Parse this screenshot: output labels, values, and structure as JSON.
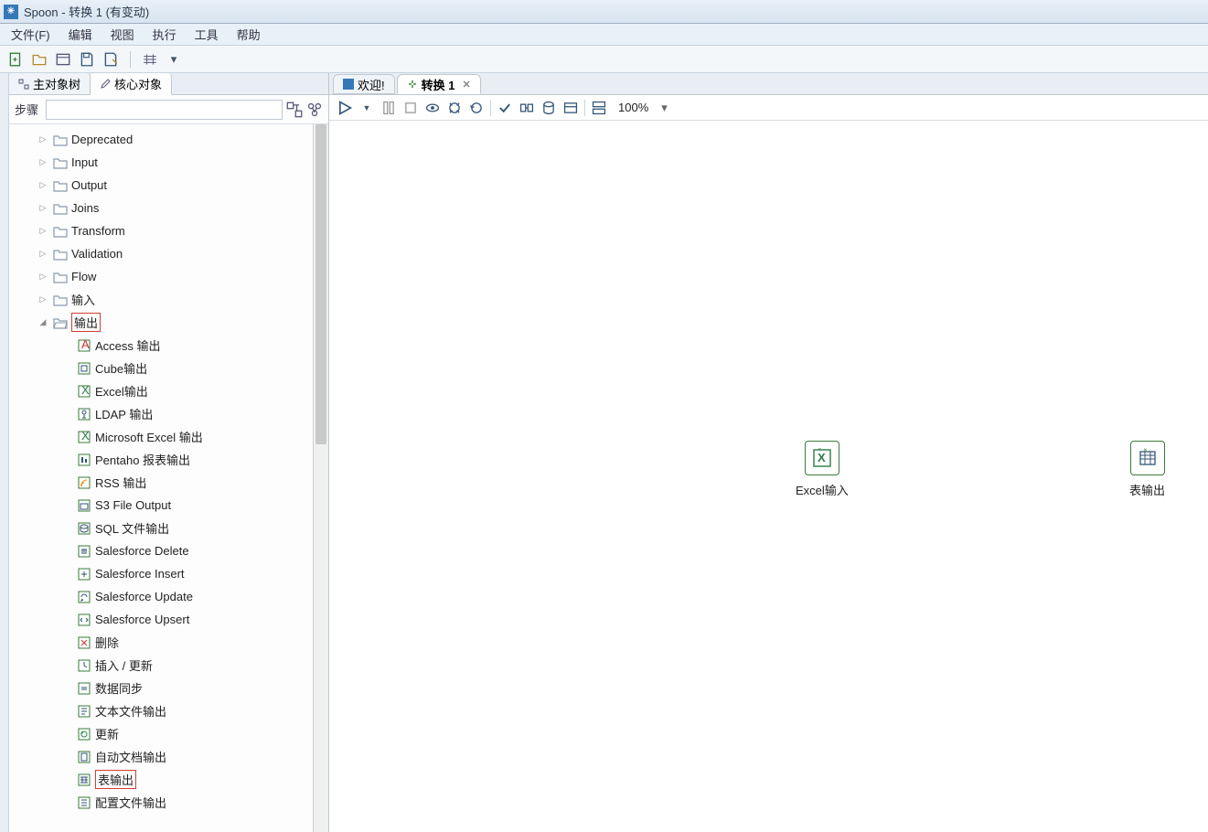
{
  "window": {
    "title": "Spoon - 转换 1 (有变动)"
  },
  "menu": {
    "file": "文件(F)",
    "edit": "编辑",
    "view": "视图",
    "run": "执行",
    "tools": "工具",
    "help": "帮助"
  },
  "sideTabs": {
    "objectTree": "主对象树",
    "coreObjects": "核心对象"
  },
  "search": {
    "label": "步骤"
  },
  "tree": {
    "folders": {
      "deprecated": "Deprecated",
      "input": "Input",
      "output": "Output",
      "joins": "Joins",
      "transform": "Transform",
      "validation": "Validation",
      "flow": "Flow",
      "inputCn": "输入",
      "outputCn": "输出"
    },
    "outputSteps": {
      "access": "Access 输出",
      "cube": "Cube输出",
      "excel": "Excel输出",
      "ldap": "LDAP 输出",
      "msexcel": "Microsoft Excel 输出",
      "pentaho": "Pentaho 报表输出",
      "rss": "RSS 输出",
      "s3": "S3 File Output",
      "sql": "SQL 文件输出",
      "sfdelete": "Salesforce Delete",
      "sfinsert": "Salesforce Insert",
      "sfupdate": "Salesforce Update",
      "sfupsert": "Salesforce Upsert",
      "delete": "删除",
      "insertUpdate": "插入 / 更新",
      "dataSync": "数据同步",
      "textfile": "文本文件输出",
      "update": "更新",
      "autoDoc": "自动文档输出",
      "tableOut": "表输出",
      "configOut": "配置文件输出"
    }
  },
  "docTabs": {
    "welcome": "欢迎!",
    "trans1": "转换 1"
  },
  "canvasToolbar": {
    "zoom": "100%"
  },
  "canvas": {
    "node1": "Excel输入",
    "node2": "表输出"
  }
}
